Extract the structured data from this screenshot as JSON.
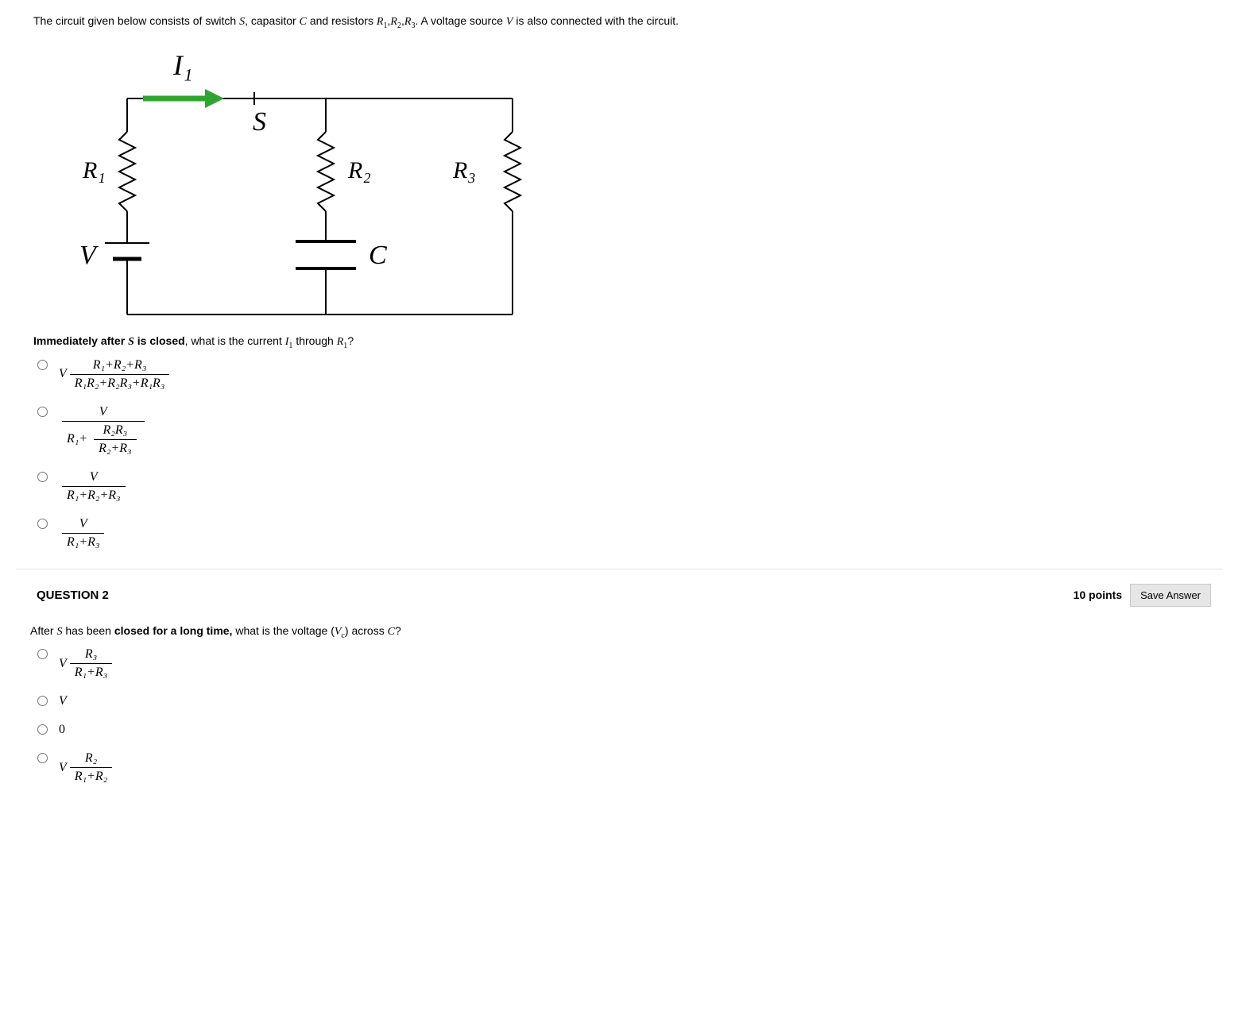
{
  "intro": {
    "pre": "The circuit given below consists of switch ",
    "S": "S",
    "mid1": ", capasitor ",
    "C": "C",
    "mid2": " and resistors ",
    "R": "R",
    "sub1": "1",
    "comma1": ",",
    "sub2": "2",
    "comma2": ",",
    "sub3": "3",
    "mid3": ". A voltage source ",
    "V": "V",
    "post": " is also connected with the circuit."
  },
  "circuit": {
    "I1": "I₁",
    "S": "S",
    "R1": "R₁",
    "R2": "R₂",
    "R3": "R₃",
    "V": "V",
    "C": "C"
  },
  "q1": {
    "prompt_pre": "Immediately after ",
    "S": "S",
    "prompt_bold": " is closed",
    "prompt_mid": ", what is the current ",
    "I": "I",
    "sub1": "1",
    "prompt_mid2": " through ",
    "R": "R",
    "sub1b": "1",
    "qmark": "?",
    "opts": {
      "a_V": "V",
      "a_num": "R₁+R₂+R₃",
      "a_den": "R₁R₂+R₂R₃+R₁R₃",
      "b_num": "V",
      "b_R1": "R₁",
      "b_plus": "+",
      "b_inner_num": "R₂R₃",
      "b_inner_den": "R₂+R₃",
      "c_num": "V",
      "c_den": "R₁+R₂+R₃",
      "d_num": "V",
      "d_den": "R₁+R₃"
    }
  },
  "q2": {
    "header": "QUESTION 2",
    "points": "10 points",
    "save": "Save Answer",
    "prompt_pre": "After ",
    "S": "S",
    "prompt_mid1": " has been ",
    "prompt_bold": "closed for a long time,",
    "prompt_mid2": " what is the voltage (",
    "V": "V",
    "sub_c": "c",
    "prompt_mid3": ") across ",
    "C": "C",
    "qmark": "?",
    "opts": {
      "a_V": "V",
      "a_num": "R₃",
      "a_den": "R₁+R₃",
      "b": "V",
      "c": "0",
      "d_V": "V",
      "d_num": "R₂",
      "d_den": "R₁+R₂"
    }
  }
}
